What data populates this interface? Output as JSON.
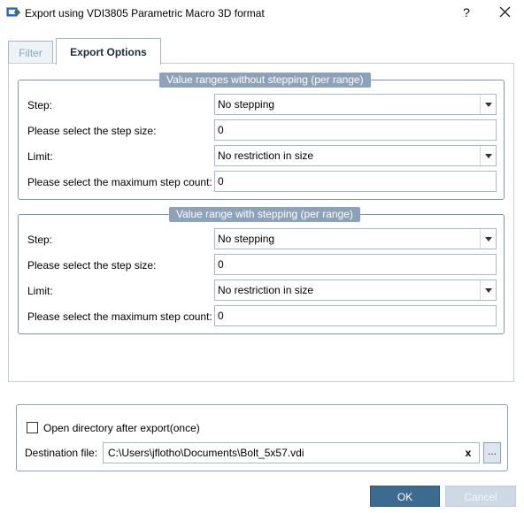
{
  "window": {
    "title": "Export using VDI3805 Parametric Macro 3D format",
    "help_label": "?",
    "icon": "export-app-icon"
  },
  "tabs": [
    {
      "label": "Filter",
      "active": false
    },
    {
      "label": "Export Options",
      "active": true
    }
  ],
  "group_without_stepping": {
    "title": "Value ranges without stepping (per range)",
    "step_label": "Step:",
    "step_value": "No stepping",
    "step_size_label": "Please select the step size:",
    "step_size_value": "0",
    "limit_label": "Limit:",
    "limit_value": "No restriction in size",
    "max_count_label": "Please select the maximum step count:",
    "max_count_value": "0"
  },
  "group_with_stepping": {
    "title": "Value range with stepping (per range)",
    "step_label": "Step:",
    "step_value": "No stepping",
    "step_size_label": "Please select the step size:",
    "step_size_value": "0",
    "limit_label": "Limit:",
    "limit_value": "No restriction in size",
    "max_count_label": "Please select the maximum step count:",
    "max_count_value": "0"
  },
  "options": {
    "open_directory_label": "Open directory after export(once)",
    "open_directory_checked": false,
    "destination_label": "Destination file:",
    "destination_value": "C:\\Users\\jflotho\\Documents\\Bolt_5x57.vdi",
    "clear_label": "x",
    "browse_label": "..."
  },
  "buttons": {
    "ok_label": "OK",
    "cancel_label": "Cancel"
  },
  "colors": {
    "group_title_bg": "#8da2b8",
    "ok_bg": "#3d6a8f",
    "cancel_bg": "#cdd9e4"
  }
}
